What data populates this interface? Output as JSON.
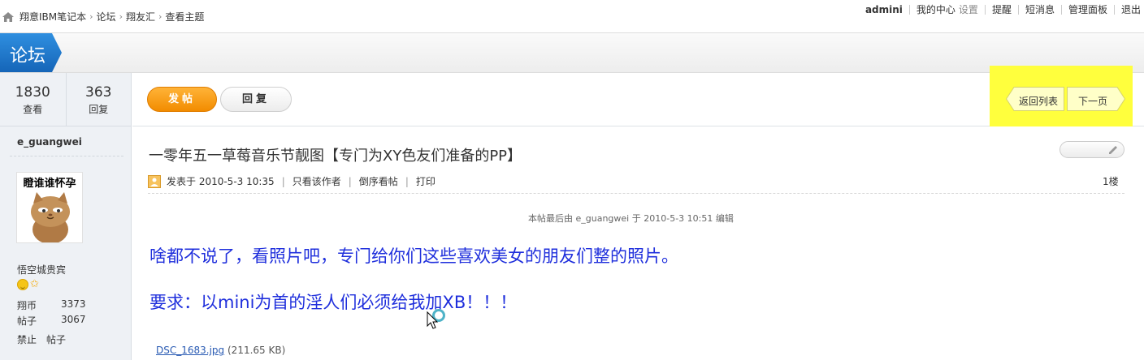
{
  "breadcrumb": {
    "items": [
      "翔意IBM笔记本",
      "论坛",
      "翔友汇",
      "查看主题"
    ],
    "separator": "›"
  },
  "userbar": {
    "username": "admini",
    "my_center": "我的中心",
    "settings": "设置",
    "remind": "提醒",
    "messages": "短消息",
    "admin_panel": "管理面板",
    "logout": "退出"
  },
  "header": {
    "forum_tab": "论坛"
  },
  "stats": {
    "views": "1830",
    "views_label": "查看",
    "replies": "363",
    "replies_label": "回复"
  },
  "author": {
    "name": "e_guangwei",
    "avatar_caption": "瞪谁谁怀孕",
    "rank": "悟空城贵宾",
    "coins_label": "翔币",
    "coins": "3373",
    "posts_label": "帖子",
    "posts": "3067",
    "ban": "禁止",
    "posts_action": "帖子"
  },
  "actionbar": {
    "post_button": "发帖",
    "reply_button": "回复",
    "back_to_list": "返回列表",
    "next_page": "下一页"
  },
  "post": {
    "title": "一零年五一草莓音乐节靓图【专门为XY色友们准备的PP】",
    "posted_at": "发表于 2010-5-3 10:35",
    "only_author": "只看该作者",
    "reverse_order": "倒序看帖",
    "print": "打印",
    "floor": "1楼",
    "edited_note": "本帖最后由 e_guangwei 于 2010-5-3 10:51 编辑",
    "line1": "啥都不说了，看照片吧，专门给你们这些喜欢美女的朋友们整的照片。",
    "line2": "要求：以mini为首的淫人们必须给我加XB！！！",
    "attachment_name": "DSC_1683.jpg",
    "attachment_size": "(211.65 KB)"
  },
  "colors": {
    "accent_blue": "#1e7bd0",
    "post_button": "#f28c00",
    "body_text": "#1f2fdc",
    "highlight": "#ffff3d"
  }
}
